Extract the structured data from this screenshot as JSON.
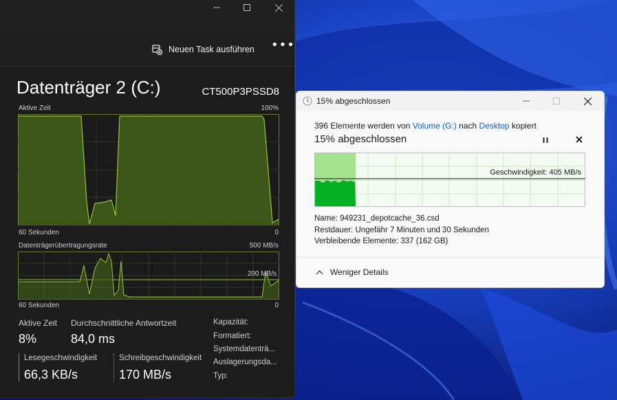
{
  "task_manager": {
    "run_task_label": "Neuen Task ausführen",
    "more_label": "•••",
    "disk_title": "Datenträger 2 (C:)",
    "disk_model": "CT500P3PSSD8",
    "active_time_graph": {
      "label": "Aktive Zeit",
      "max_label": "100%",
      "time_label": "60 Sekunden",
      "min_label": "0"
    },
    "transfer_graph": {
      "label": "Datenträgerübertragungsrate",
      "max_label": "500 MB/s",
      "marker_label": "200 MB/s",
      "time_label": "60 Sekunden",
      "min_label": "0"
    },
    "stats": {
      "active_time_label": "Aktive Zeit",
      "active_time_value": "8%",
      "avg_response_label": "Durchschnittliche Antwortzeit",
      "avg_response_value": "84,0 ms",
      "read_speed_label": "Lesegeschwindigkeit",
      "read_speed_value": "66,3 KB/s",
      "write_speed_label": "Schreibgeschwindigkeit",
      "write_speed_value": "170 MB/s"
    },
    "properties": [
      "Kapazität:",
      "Formatiert:",
      "Systemdatenträ...",
      "Auslagerungsda...",
      "Typ:"
    ]
  },
  "copy_dialog": {
    "window_title": "15% abgeschlossen",
    "summary_count": "396 Elemente werden von",
    "source_link": "Volume (G:)",
    "summary_mid": "nach",
    "dest_link": "Desktop",
    "summary_end": "kopiert",
    "percent_heading": "15% abgeschlossen",
    "progress_fraction": 0.15,
    "speed_label": "Geschwindigkeit: 405 MB/s",
    "name_label": "Name:",
    "name_value": "949231_depotcache_36.csd",
    "remaining_label": "Restdauer:",
    "remaining_value": "Ungefähr 7 Minuten und 30 Sekunden",
    "items_label": "Verbleibende Elemente:",
    "items_value": "337 (162 GB)",
    "less_details_label": "Weniger Details"
  },
  "colors": {
    "graph_green": "#9bc53d",
    "graph_fill": "#3e5a1a",
    "progress_green": "#06b025",
    "progress_light": "#a6e38f",
    "link_blue": "#0b5fb9"
  }
}
